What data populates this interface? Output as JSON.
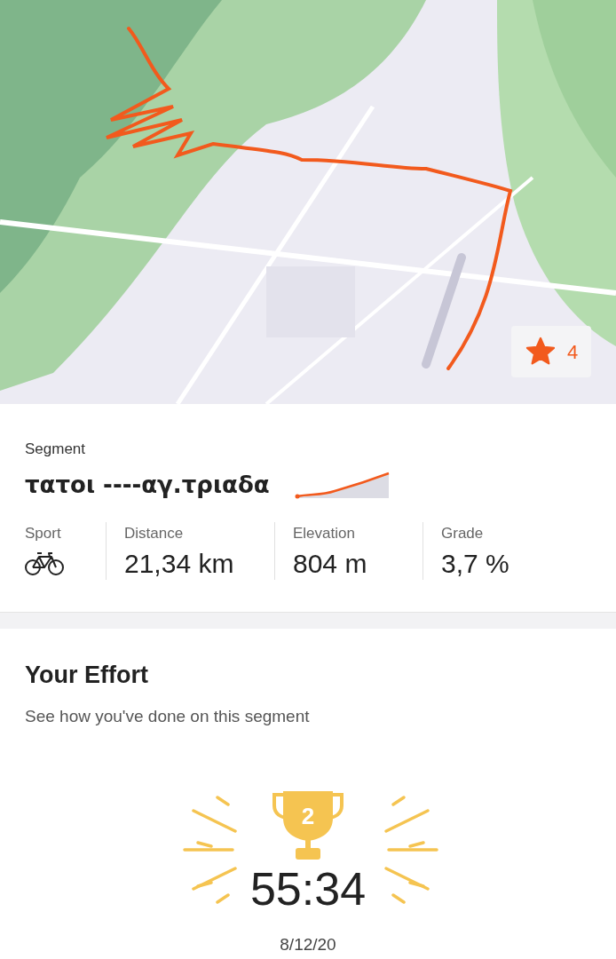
{
  "map": {
    "kind": "picture",
    "star_count": "4",
    "starred": true
  },
  "segment": {
    "label": "Segment",
    "name": "τατοι ----αγ.τριαδα",
    "stats": [
      {
        "kind": "sport",
        "label": "Sport"
      },
      {
        "kind": "text",
        "label": "Distance",
        "value": "21,34 km"
      },
      {
        "kind": "text",
        "label": "Elevation",
        "value": "804 m"
      },
      {
        "kind": "text",
        "label": "Grade",
        "value": "3,7 %"
      }
    ]
  },
  "effort": {
    "title": "Your Effort",
    "subtitle": "See how you've done on this segment",
    "rank": "2",
    "time": "55:34",
    "date": "8/12/20"
  }
}
